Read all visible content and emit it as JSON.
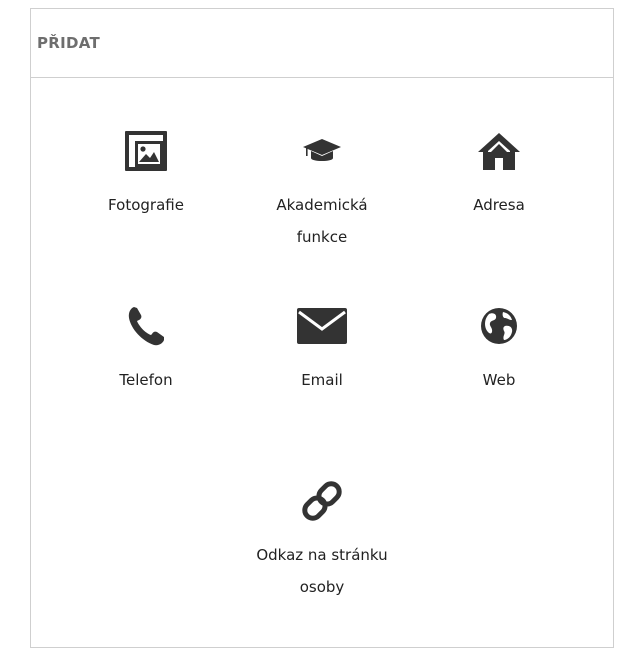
{
  "panel": {
    "title": "PŘIDAT"
  },
  "items": [
    {
      "label": "Fotografie",
      "icon": "photo-icon"
    },
    {
      "label_line1": "Akademická",
      "label_line2": "funkce",
      "icon": "graduation-cap-icon"
    },
    {
      "label": "Adresa",
      "icon": "home-icon"
    },
    {
      "label": "Telefon",
      "icon": "phone-icon"
    },
    {
      "label": "Email",
      "icon": "envelope-icon"
    },
    {
      "label": "Web",
      "icon": "globe-icon"
    },
    {
      "label_line1": "Odkaz na stránku",
      "label_line2": "osoby",
      "icon": "link-icon"
    }
  ],
  "colors": {
    "icon": "#333333",
    "title": "#6e6e6e",
    "border": "#cfcfcf"
  }
}
